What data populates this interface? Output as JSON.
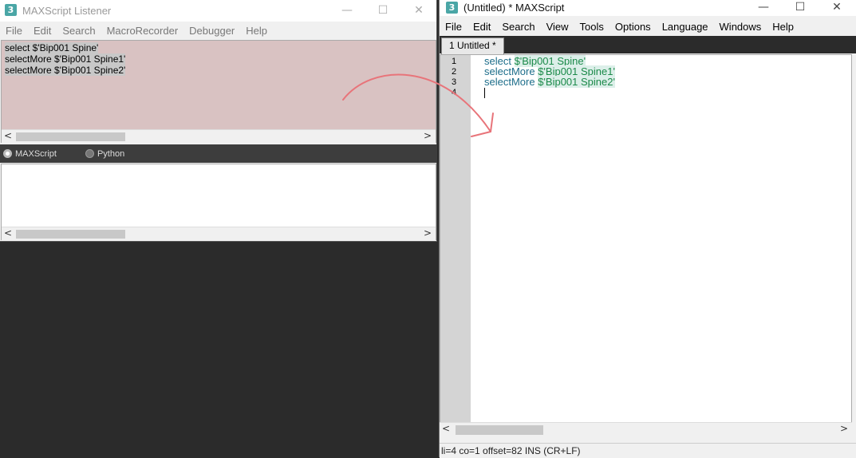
{
  "listener": {
    "title": "MAXScript Listener",
    "icon_label": "3",
    "menu": [
      "File",
      "Edit",
      "Search",
      "MacroRecorder",
      "Debugger",
      "Help"
    ],
    "macro_lines": [
      "select $'Bip001 Spine'",
      "selectMore $'Bip001 Spine1'",
      "selectMore $'Bip001 Spine2'"
    ],
    "modes": [
      {
        "label": "MAXScript",
        "checked": true
      },
      {
        "label": "Python",
        "checked": false
      }
    ]
  },
  "editor": {
    "title": "(Untitled) * MAXScript",
    "icon_label": "3",
    "menu": [
      "File",
      "Edit",
      "Search",
      "View",
      "Tools",
      "Options",
      "Language",
      "Windows",
      "Help"
    ],
    "tab_label": "1 Untitled *",
    "line_numbers": [
      "1",
      "2",
      "3",
      "4"
    ],
    "lines": [
      {
        "keyword": "select ",
        "arg": "$'Bip001 Spine'"
      },
      {
        "keyword": "selectMore ",
        "arg": "$'Bip001 Spine1'"
      },
      {
        "keyword": "selectMore ",
        "arg": "$'Bip001 Spine2'"
      }
    ],
    "status": "li=4 co=1 offset=82 INS (CR+LF)"
  },
  "window_buttons": {
    "minimize": "—",
    "maximize": "☐",
    "close": "✕"
  },
  "scroll_arrows": {
    "left": "<",
    "right": ">"
  },
  "colors": {
    "annotation_arrow": "#e8747a",
    "macro_bg": "#d9c2c2",
    "keyword": "#1c6d8a",
    "string": "#1c8a4a"
  },
  "icons": [
    "app-3dsmax-icon",
    "minimize-icon",
    "maximize-icon",
    "close-icon",
    "scroll-left-icon",
    "scroll-right-icon",
    "annotation-arrow-icon"
  ]
}
